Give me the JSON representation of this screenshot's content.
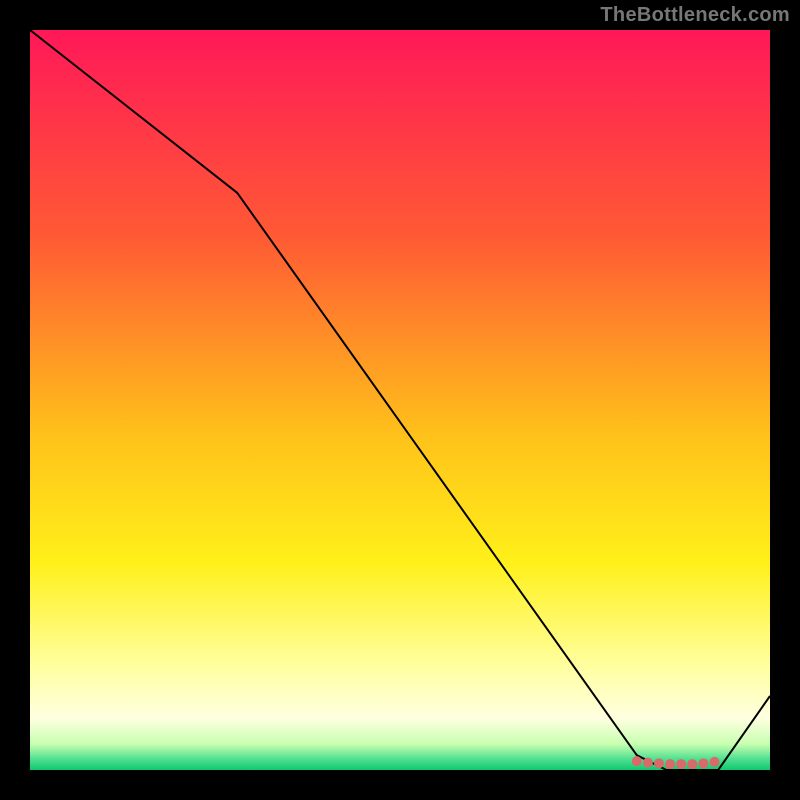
{
  "attribution": "TheBottleneck.com",
  "chart_data": {
    "type": "line",
    "title": "",
    "xlabel": "",
    "ylabel": "",
    "xlim": [
      0,
      100
    ],
    "ylim": [
      0,
      100
    ],
    "x": [
      0,
      28,
      82,
      86,
      93,
      100
    ],
    "values": [
      100,
      78,
      2,
      0,
      0,
      10
    ],
    "marker_points": {
      "x": [
        82,
        83.5,
        85,
        86.5,
        88,
        89.5,
        91,
        92.5
      ],
      "y": [
        1.2,
        1.0,
        0.9,
        0.8,
        0.8,
        0.8,
        0.9,
        1.1
      ]
    },
    "gradient_stops": [
      {
        "offset": 0.0,
        "color": "#ff1858"
      },
      {
        "offset": 0.28,
        "color": "#ff5a34"
      },
      {
        "offset": 0.55,
        "color": "#ffc21a"
      },
      {
        "offset": 0.72,
        "color": "#fff01a"
      },
      {
        "offset": 0.86,
        "color": "#ffffa0"
      },
      {
        "offset": 0.93,
        "color": "#ffffe0"
      },
      {
        "offset": 0.965,
        "color": "#c8ffb0"
      },
      {
        "offset": 0.985,
        "color": "#50e090"
      },
      {
        "offset": 1.0,
        "color": "#10c870"
      }
    ],
    "curve_color": "#000000",
    "curve_width": 2,
    "marker_color": "#d86a6a",
    "marker_radius": 5
  }
}
